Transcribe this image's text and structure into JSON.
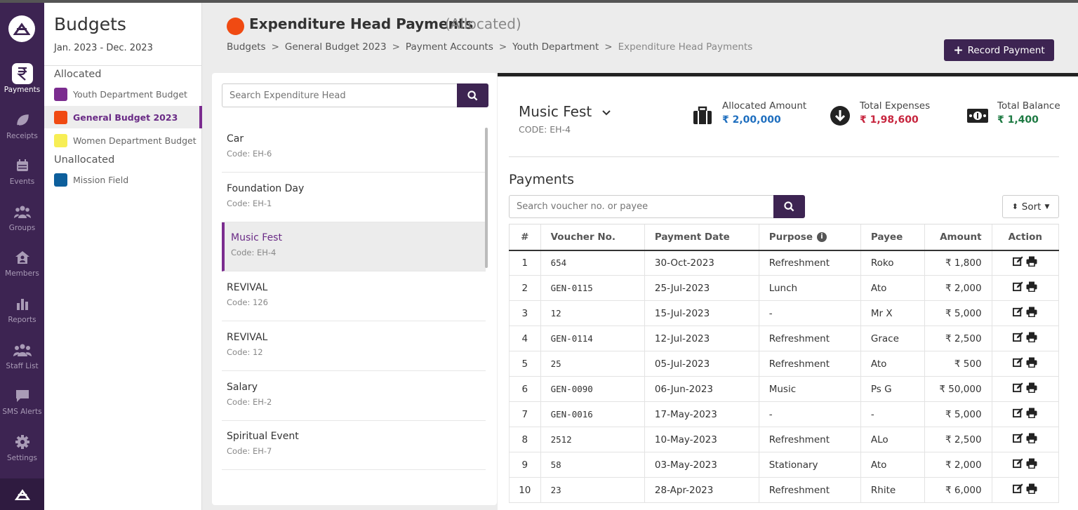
{
  "rail": {
    "items": [
      {
        "label": "Payments",
        "icon": "rupee-icon",
        "active": true
      },
      {
        "label": "Receipts",
        "icon": "leaf-icon"
      },
      {
        "label": "Events",
        "icon": "calendar-icon"
      },
      {
        "label": "Groups",
        "icon": "groups-icon"
      },
      {
        "label": "Members",
        "icon": "home-user-icon"
      },
      {
        "label": "Reports",
        "icon": "bar-chart-icon"
      },
      {
        "label": "Staff List",
        "icon": "staff-icon"
      },
      {
        "label": "SMS Alerts",
        "icon": "message-icon"
      },
      {
        "label": "Settings",
        "icon": "gear-icon"
      }
    ]
  },
  "budgets": {
    "title": "Budgets",
    "range": "Jan. 2023 - Dec. 2023",
    "allocated_label": "Allocated",
    "unallocated_label": "Unallocated",
    "allocated": [
      {
        "label": "Youth Department Budget",
        "color": "#7b2c8f"
      },
      {
        "label": "General Budget 2023",
        "color": "#f04a12",
        "active": true
      },
      {
        "label": "Women Department Budget",
        "color": "#f7ee55"
      }
    ],
    "unallocated": [
      {
        "label": "Mission Field",
        "color": "#0d5f9c"
      }
    ]
  },
  "header": {
    "title": "Expenditure Head Payments",
    "subtitle": "(Allocated)",
    "dot_color": "#f04a12",
    "breadcrumbs": [
      "Budgets",
      "General Budget 2023",
      "Payment Accounts",
      "Youth Department",
      "Expenditure Head Payments"
    ],
    "record_button": "Record Payment"
  },
  "heads": {
    "search_placeholder": "Search Expenditure Head",
    "items": [
      {
        "name": "Car",
        "code": "Code: EH-6"
      },
      {
        "name": "Foundation Day",
        "code": "Code: EH-1"
      },
      {
        "name": "Music Fest",
        "code": "Code: EH-4",
        "active": true
      },
      {
        "name": "REVIVAL",
        "code": "Code: 126"
      },
      {
        "name": "REVIVAL",
        "code": "Code: 12"
      },
      {
        "name": "Salary",
        "code": "Code: EH-2"
      },
      {
        "name": "Spiritual Event",
        "code": "Code: EH-7"
      }
    ]
  },
  "detail": {
    "name": "Music Fest",
    "code": "CODE: EH-4",
    "stats": [
      {
        "label": "Allocated Amount",
        "value": "₹ 2,00,000",
        "color": "#1f6fbf",
        "icon": "briefcase-icon"
      },
      {
        "label": "Total Expenses",
        "value": "₹ 1,98,600",
        "color": "#c7253e",
        "icon": "arrow-down-circle-icon"
      },
      {
        "label": "Total Balance",
        "value": "₹ 1,400",
        "color": "#1e7a43",
        "icon": "cash-icon"
      }
    ],
    "payments_title": "Payments",
    "search_placeholder": "Search voucher no. or payee",
    "sort_label": "Sort",
    "columns": [
      "#",
      "Voucher No.",
      "Payment Date",
      "Purpose",
      "Payee",
      "Amount",
      "Action"
    ],
    "rows": [
      {
        "n": "1",
        "voucher": "654",
        "date": "30-Oct-2023",
        "purpose": "Refreshment",
        "payee": "Roko",
        "amount": "₹ 1,800"
      },
      {
        "n": "2",
        "voucher": "GEN-0115",
        "date": "25-Jul-2023",
        "purpose": "Lunch",
        "payee": "Ato",
        "amount": "₹ 2,000"
      },
      {
        "n": "3",
        "voucher": "12",
        "date": "15-Jul-2023",
        "purpose": "-",
        "payee": "Mr X",
        "amount": "₹ 5,000"
      },
      {
        "n": "4",
        "voucher": "GEN-0114",
        "date": "12-Jul-2023",
        "purpose": "Refreshment",
        "payee": "Grace",
        "amount": "₹ 2,500"
      },
      {
        "n": "5",
        "voucher": "25",
        "date": "05-Jul-2023",
        "purpose": "Refreshment",
        "payee": "Ato",
        "amount": "₹ 500"
      },
      {
        "n": "6",
        "voucher": "GEN-0090",
        "date": "06-Jun-2023",
        "purpose": "Music",
        "payee": "Ps G",
        "amount": "₹ 50,000"
      },
      {
        "n": "7",
        "voucher": "GEN-0016",
        "date": "17-May-2023",
        "purpose": "-",
        "payee": "-",
        "amount": "₹ 5,000"
      },
      {
        "n": "8",
        "voucher": "2512",
        "date": "10-May-2023",
        "purpose": "Refreshment",
        "payee": "ALo",
        "amount": "₹ 2,500"
      },
      {
        "n": "9",
        "voucher": "58",
        "date": "03-May-2023",
        "purpose": "Stationary",
        "payee": "Ato",
        "amount": "₹ 2,000"
      },
      {
        "n": "10",
        "voucher": "23",
        "date": "28-Apr-2023",
        "purpose": "Refreshment",
        "payee": "Rhite",
        "amount": "₹ 6,000"
      }
    ]
  }
}
